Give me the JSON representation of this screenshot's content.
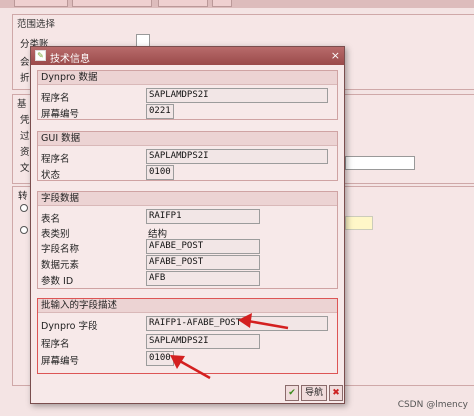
{
  "background": {
    "range_group_title": "范围选择",
    "labels": [
      "分类账",
      "会",
      "折",
      "凭",
      "过",
      "资",
      "文",
      "转"
    ],
    "base_group_title": "基"
  },
  "dialog": {
    "title": "技术信息",
    "close_icon": "close-x-icon",
    "dynpro_group": {
      "title": "Dynpro 数据",
      "program_label": "程序名",
      "program_value": "SAPLAMDPS2I",
      "screen_label": "屏幕编号",
      "screen_value": "0221"
    },
    "gui_group": {
      "title": "GUI 数据",
      "program_label": "程序名",
      "program_value": "SAPLAMDPS2I",
      "status_label": "状态",
      "status_value": "0100"
    },
    "field_group": {
      "title": "字段数据",
      "table_label": "表名",
      "table_value": "RAIFP1",
      "table_type_label": "表类别",
      "table_type_value": "结构",
      "field_label": "字段名称",
      "field_value": "AFABE_POST",
      "element_label": "数据元素",
      "element_value": "AFABE_POST",
      "param_label": "参数 ID",
      "param_value": "AFB"
    },
    "batch_group": {
      "title": "批输入的字段描述",
      "dynpro_field_label": "Dynpro 字段",
      "dynpro_field_value": "RAIFP1-AFABE_POST",
      "program_label": "程序名",
      "program_value": "SAPLAMDPS2I",
      "screen_label": "屏幕编号",
      "screen_value": "0100"
    },
    "buttons": {
      "ok_icon": "✔",
      "nav_label": "导航",
      "cancel_icon": "✖"
    }
  },
  "watermark": "CSDN @lmency",
  "colors": {
    "arrow": "#d42020",
    "titlebar": "#9a4a4a"
  }
}
